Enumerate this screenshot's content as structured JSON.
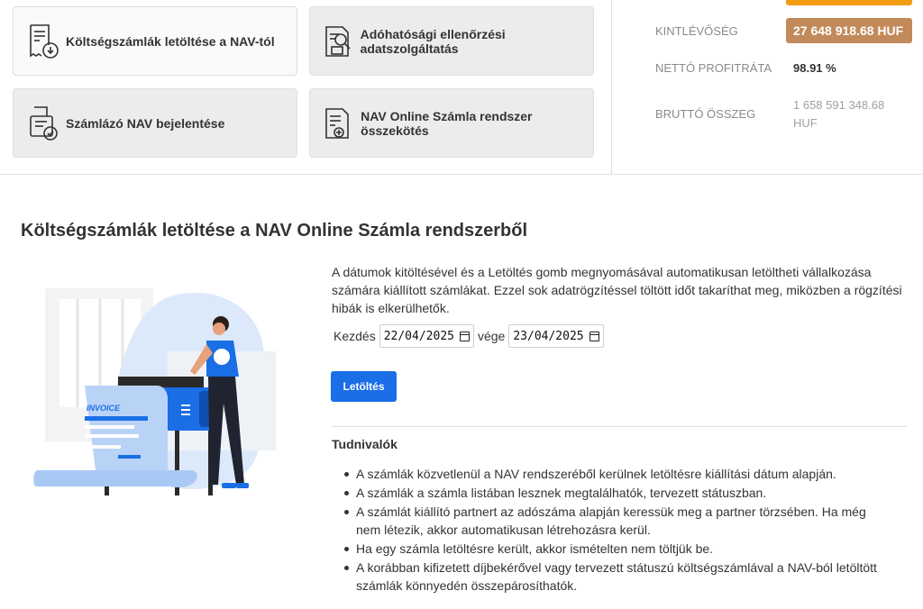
{
  "tiles": [
    {
      "label": "Költségszámlák letöltése a NAV-tól",
      "icon": "invoice-download-icon"
    },
    {
      "label": "Adóhatósági ellenőrzési adatszolgáltatás",
      "icon": "document-search-icon"
    },
    {
      "label": "Számlázó NAV bejelentése",
      "icon": "register-check-icon"
    },
    {
      "label": "NAV Online Számla rendszer összekötés",
      "icon": "document-connect-icon"
    }
  ],
  "stats": {
    "outstanding_label": "KINTLÉVŐSÉG",
    "outstanding_value": "27 648 918.68 HUF",
    "profit_label": "NETTÓ PROFITRÁTA",
    "profit_value": "98.91 %",
    "gross_label": "BRUTTÓ ÖSSZEG",
    "gross_value_line1": "1 658 591 348.68",
    "gross_value_line2": "HUF"
  },
  "colors": {
    "accent": "#1a6ee6",
    "badge": "#c28a5a",
    "orange": "#f39c12"
  },
  "main": {
    "title": "Költségszámlák letöltése a NAV Online Számla rendszerből",
    "intro": "A dátumok kitöltésével és a Letöltés gomb megnyomásával automatikusan letöltheti vállalkozása számára kiállított számlákat. Ezzel sok adatrögzítéssel töltött időt takaríthat meg, miközben a rögzítési hibák is elkerülhetők.",
    "start_label": "Kezdés",
    "start_value": "22/04/2025",
    "end_label": "vége",
    "end_value": "23/04/2025",
    "download_button": "Letöltés",
    "illustration_text": "INVOICE",
    "notes_title": "Tudnivalók",
    "notes": [
      "A számlák közvetlenül a NAV rendszeréből kerülnek letöltésre kiállítási dátum alapján.",
      "A számlák a számla listában lesznek megtalálhatók, tervezett státuszban.",
      "A számlát kiállító partnert az adószáma alapján keressük meg a partner törzsében. Ha még nem létezik, akkor automatikusan létrehozásra kerül.",
      "Ha egy számla letöltésre került, akkor ismételten nem töltjük be.",
      "A korábban kifizetett díjbekérővel vagy tervezett státuszú költségszámlával a NAV-ból letöltött számlák könnyedén összepárosíthatók."
    ]
  }
}
